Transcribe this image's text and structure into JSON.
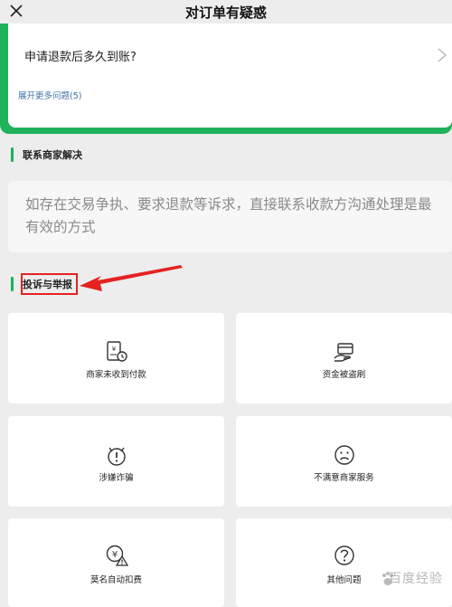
{
  "nav": {
    "title": "对订单有疑惑",
    "close_icon": "close-icon"
  },
  "faq": {
    "question": "申请退款后多久到账?",
    "more_label": "展开更多问题(5)",
    "accent_color": "#1fb25b"
  },
  "merchant_section": {
    "header": "联系商家解决",
    "description": "如存在交易争执、要求退款等诉求，直接联系收款方沟通处理是最有效的方式"
  },
  "complaint_section": {
    "header": "投诉与举报",
    "options": [
      {
        "label": "商家未收到付款",
        "icon": "receipt-clock-icon"
      },
      {
        "label": "资金被盗刷",
        "icon": "card-hand-icon"
      },
      {
        "label": "涉嫌诈骗",
        "icon": "alert-face-icon"
      },
      {
        "label": "不满意商家服务",
        "icon": "sad-face-icon"
      },
      {
        "label": "莫名自动扣费",
        "icon": "yen-warning-icon"
      },
      {
        "label": "其他问题",
        "icon": "question-icon"
      }
    ]
  },
  "watermark": "百度经验"
}
